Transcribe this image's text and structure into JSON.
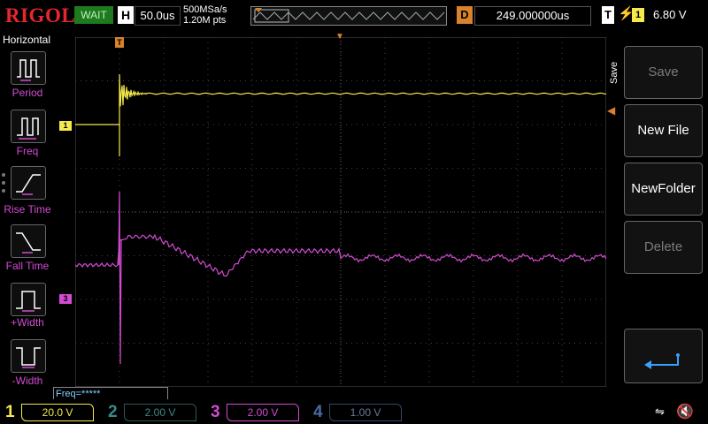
{
  "header": {
    "brand": "RIGOL",
    "run_status": "WAIT",
    "timebase_label": "H",
    "timebase_value": "50.0us",
    "sample_rate": "500MSa/s",
    "memory_depth": "1.20M pts",
    "delay_label": "D",
    "delay_value": "249.000000us",
    "trigger_label": "T",
    "trigger_source": "1",
    "trigger_level": "6.80 V"
  },
  "left_menu": {
    "title": "Horizontal",
    "items": [
      {
        "label": "Period"
      },
      {
        "label": "Freq"
      },
      {
        "label": "Rise Time"
      },
      {
        "label": "Fall Time"
      },
      {
        "label": "+Width"
      },
      {
        "label": "-Width"
      }
    ]
  },
  "grid": {
    "trigger_marker": "T",
    "ch1_marker": "1",
    "ch3_marker": "3",
    "freq_readout": "Freq=*****"
  },
  "right_menu": {
    "tab_title": "Save",
    "buttons": [
      {
        "label": "Save",
        "enabled": false
      },
      {
        "label": "New File",
        "enabled": true
      },
      {
        "label": "NewFolder",
        "enabled": true
      },
      {
        "label": "Delete",
        "enabled": false
      }
    ]
  },
  "channels": [
    {
      "num": "1",
      "scale": "20.0 V",
      "active": true,
      "color": "#f5e94b"
    },
    {
      "num": "2",
      "scale": "2.00 V",
      "active": false,
      "color": "#3a8a8a"
    },
    {
      "num": "3",
      "scale": "2.00 V",
      "active": true,
      "color": "#d24bd2"
    },
    {
      "num": "4",
      "scale": "1.00 V",
      "active": false,
      "color": "#4a6aa0"
    }
  ],
  "colors": {
    "ch1": "#f5e94b",
    "ch3": "#d24bd2",
    "trigger": "#d8822b",
    "brand": "#e8262d"
  }
}
